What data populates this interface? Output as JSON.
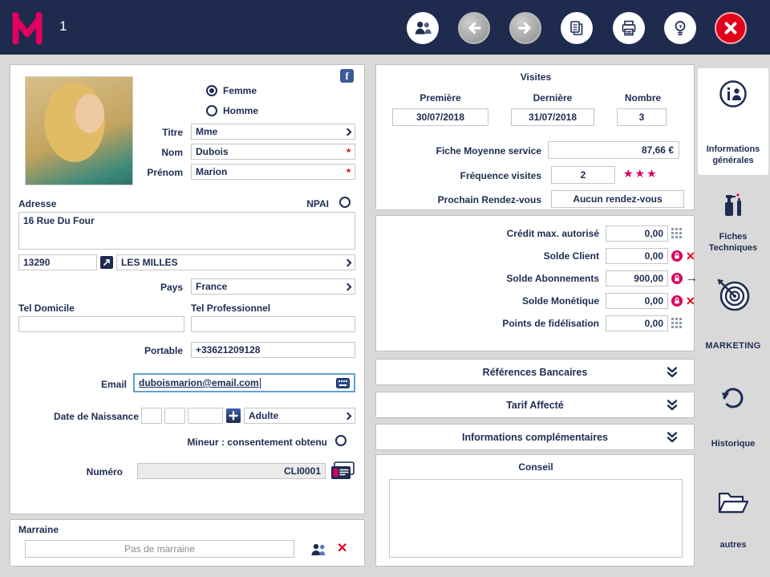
{
  "header": {
    "window_number": "1"
  },
  "client": {
    "gender_female": "Femme",
    "gender_male": "Homme",
    "titre_label": "Titre",
    "titre_value": "Mme",
    "nom_label": "Nom",
    "nom_value": "Dubois",
    "prenom_label": "Prénom",
    "prenom_value": "Marion",
    "required_marker": "*",
    "adresse_label": "Adresse",
    "npai_label": "NPAI",
    "adresse_value": "16 Rue Du Four",
    "code_postal": "13290",
    "ville": "LES MILLES",
    "pays_label": "Pays",
    "pays_value": "France",
    "tel_domicile_label": "Tel Domicile",
    "tel_domicile_value": "",
    "tel_professionnel_label": "Tel Professionnel",
    "tel_professionnel_value": "",
    "portable_label": "Portable",
    "portable_value": "+33621209128",
    "email_label": "Email",
    "email_value": "duboismarion@email.com",
    "date_naissance_label": "Date de Naissance",
    "age_category": "Adulte",
    "mineur_label": "Mineur : consentement obtenu",
    "numero_label": "Numéro",
    "numero_value": "CLI0001"
  },
  "marraine": {
    "title": "Marraine",
    "value": "Pas de marraine"
  },
  "visites": {
    "title": "Visites",
    "col_premiere": "Première",
    "col_derniere": "Dernière",
    "col_nombre": "Nombre",
    "premiere_value": "30/07/2018",
    "derniere_value": "31/07/2018",
    "nombre_value": "3",
    "fiche_moyenne_label": "Fiche Moyenne service",
    "fiche_moyenne_value": "87,66 €",
    "frequence_label": "Fréquence visites",
    "frequence_value": "2",
    "stars": "★★★",
    "prochain_rdv_label": "Prochain Rendez-vous",
    "prochain_rdv_value": "Aucun rendez-vous"
  },
  "soldes": {
    "rows": [
      {
        "label": "Crédit max. autorisé",
        "value": "0,00",
        "icon1": "numpad-icon",
        "icon2": ""
      },
      {
        "label": "Solde Client",
        "value": "0,00",
        "icon1": "lock-icon",
        "icon2": "delete-icon"
      },
      {
        "label": "Solde Abonnements",
        "value": "900,00",
        "icon1": "lock-icon",
        "icon2": "transfer-icon"
      },
      {
        "label": "Solde Monétique",
        "value": "0,00",
        "icon1": "lock-icon",
        "icon2": "delete-icon"
      },
      {
        "label": "Points de fidélisation",
        "value": "0,00",
        "icon1": "numpad-icon",
        "icon2": ""
      }
    ]
  },
  "sections": [
    {
      "label": "Références Bancaires"
    },
    {
      "label": "Tarif Affecté"
    },
    {
      "label": "Informations complémentaires"
    }
  ],
  "conseil": {
    "title": "Conseil",
    "content": ""
  },
  "sidebar": {
    "items": [
      {
        "label": "Informations générales"
      },
      {
        "label": "Fiches Techniques"
      },
      {
        "label": "MARKETING"
      },
      {
        "label": "Historique"
      },
      {
        "label": "autres"
      }
    ]
  },
  "colors": {
    "accent_pink": "#d8035e",
    "navy": "#1f2c52",
    "alert_red": "#e2001a"
  }
}
